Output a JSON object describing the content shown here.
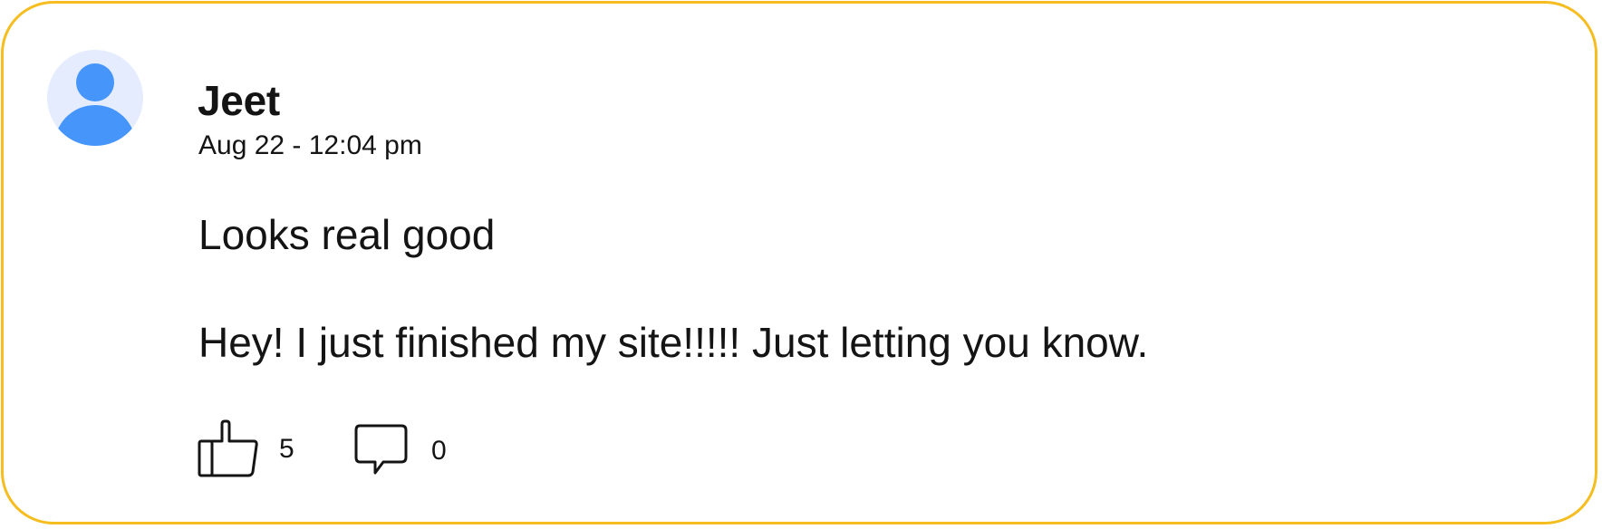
{
  "comment": {
    "author": "Jeet",
    "timestamp": "Aug 22 - 12:04 pm",
    "body_lines": [
      "Looks real good",
      "Hey! I just finished my site!!!!! Just letting you know."
    ],
    "avatar_icon": "user-avatar-icon",
    "actions": {
      "like": {
        "icon": "thumbs-up-icon",
        "count": "5"
      },
      "reply": {
        "icon": "speech-bubble-icon",
        "count": "0"
      }
    }
  },
  "colors": {
    "card_border": "#f5bd1f",
    "avatar_background": "#e5ecfd",
    "avatar_figure": "#4595fb",
    "text": "#141414"
  }
}
